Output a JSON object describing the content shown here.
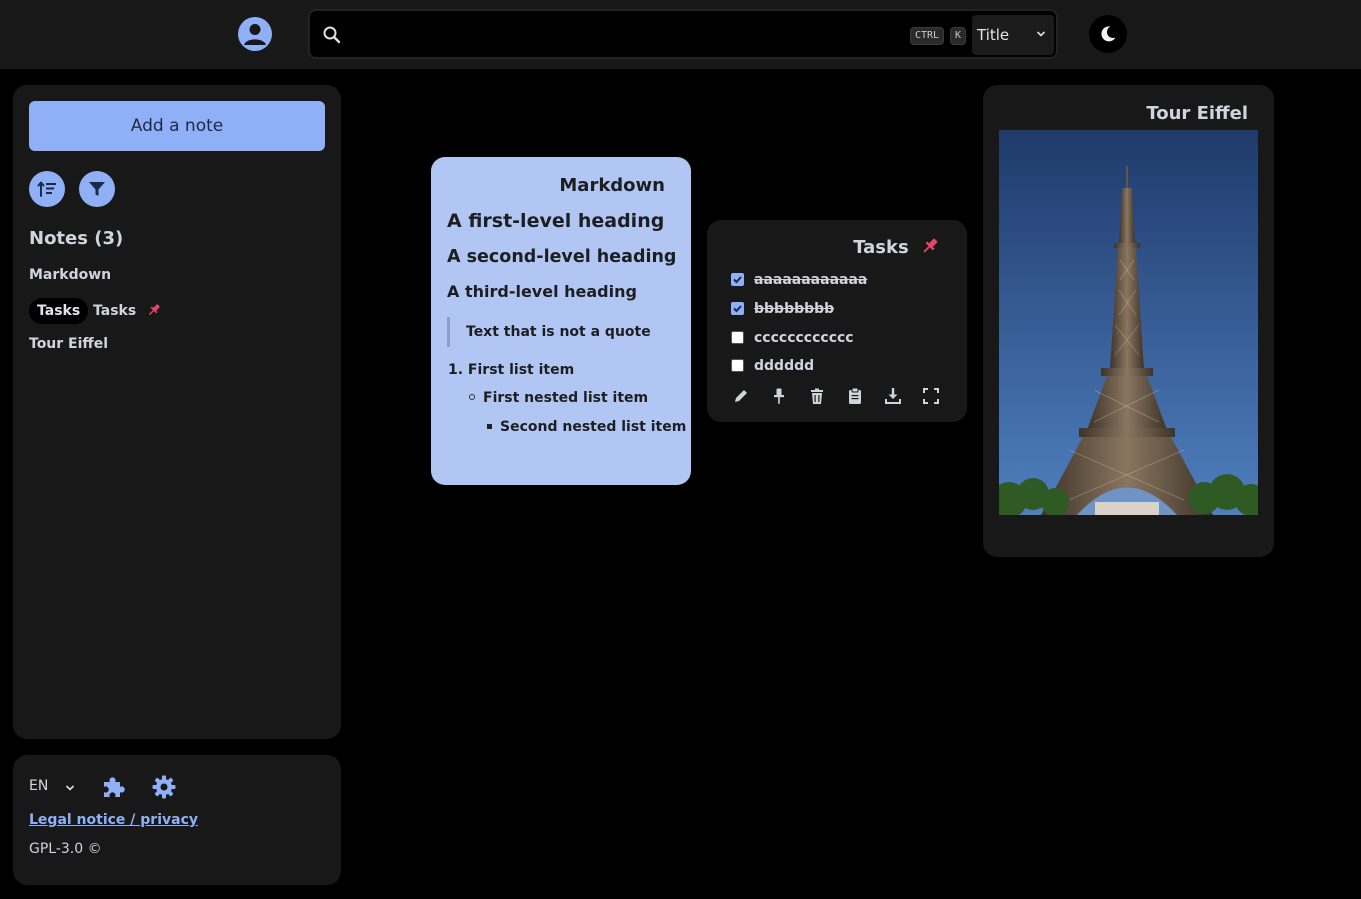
{
  "header": {
    "search": {
      "placeholder": "",
      "kbd_ctrl": "CTRL",
      "kbd_k": "K",
      "mode": "Title"
    }
  },
  "sidebar": {
    "add_label": "Add a note",
    "notes_title": "Notes (3)",
    "notes": [
      {
        "label": "Markdown"
      },
      {
        "label": "Tasks",
        "tag": "Tasks",
        "pinned": true
      },
      {
        "label": "Tour Eiffel"
      }
    ]
  },
  "footer": {
    "lang": "EN",
    "legal": "Legal notice / privacy",
    "license": "GPL-3.0 ©"
  },
  "cards": {
    "markdown": {
      "title": "Markdown",
      "h1": "A first-level heading",
      "h2": "A second-level heading",
      "h3": "A third-level heading",
      "quote": "Text that is not a quote",
      "list1": "1. First list item",
      "list2": "First nested list item",
      "list3": "Second nested list item"
    },
    "tasks": {
      "title": "Tasks",
      "items": [
        {
          "text": "aaaaaaaaaaaa",
          "checked": true
        },
        {
          "text": "bbbbbbbb",
          "checked": true
        },
        {
          "text": "cccccccccccc",
          "checked": false
        },
        {
          "text": "dddddd",
          "checked": false
        }
      ]
    },
    "image": {
      "title": "Tour Eiffel"
    }
  },
  "colors": {
    "accent": "#8fb0f7",
    "pin": "#e8456b",
    "card_md": "#b2c6f4",
    "panel": "#181818"
  }
}
